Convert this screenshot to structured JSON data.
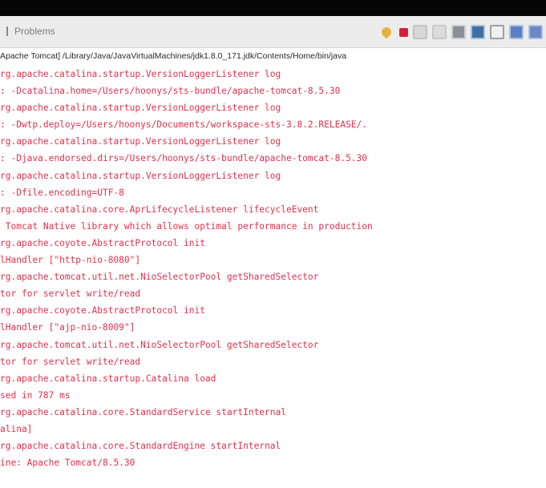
{
  "tabs": {
    "problems": "Problems"
  },
  "toolbar": {
    "icons": [
      "pin-icon",
      "stop-icon",
      "remove-launch-icon",
      "remove-all-icon",
      "clear-console-icon",
      "scroll-lock-icon",
      "word-wrap-icon",
      "display-console-icon",
      "open-console-icon"
    ]
  },
  "console": {
    "launch": "Apache Tomcat] /Library/Java/JavaVirtualMachines/jdk1.8.0_171.jdk/Contents/Home/bin/java",
    "lines": [
      "rg.apache.catalina.startup.VersionLoggerListener log",
      ": -Dcatalina.home=/Users/hoonys/sts-bundle/apache-tomcat-8.5.30",
      "rg.apache.catalina.startup.VersionLoggerListener log",
      ": -Dwtp.deploy=/Users/hoonys/Documents/workspace-sts-3.8.2.RELEASE/.",
      "rg.apache.catalina.startup.VersionLoggerListener log",
      ": -Djava.endorsed.dirs=/Users/hoonys/sts-bundle/apache-tomcat-8.5.30",
      "rg.apache.catalina.startup.VersionLoggerListener log",
      ": -Dfile.encoding=UTF-8",
      "rg.apache.catalina.core.AprLifecycleListener lifecycleEvent",
      " Tomcat Native library which allows optimal performance in production",
      "rg.apache.coyote.AbstractProtocol init",
      "lHandler [\"http-nio-8080\"]",
      "rg.apache.tomcat.util.net.NioSelectorPool getSharedSelector",
      "tor for servlet write/read",
      "rg.apache.coyote.AbstractProtocol init",
      "lHandler [\"ajp-nio-8009\"]",
      "rg.apache.tomcat.util.net.NioSelectorPool getSharedSelector",
      "tor for servlet write/read",
      "rg.apache.catalina.startup.Catalina load",
      "sed in 787 ms",
      "rg.apache.catalina.core.StandardService startInternal",
      "alina]",
      "rg.apache.catalina.core.StandardEngine startInternal",
      "ine: Apache Tomcat/8.5.30"
    ]
  }
}
